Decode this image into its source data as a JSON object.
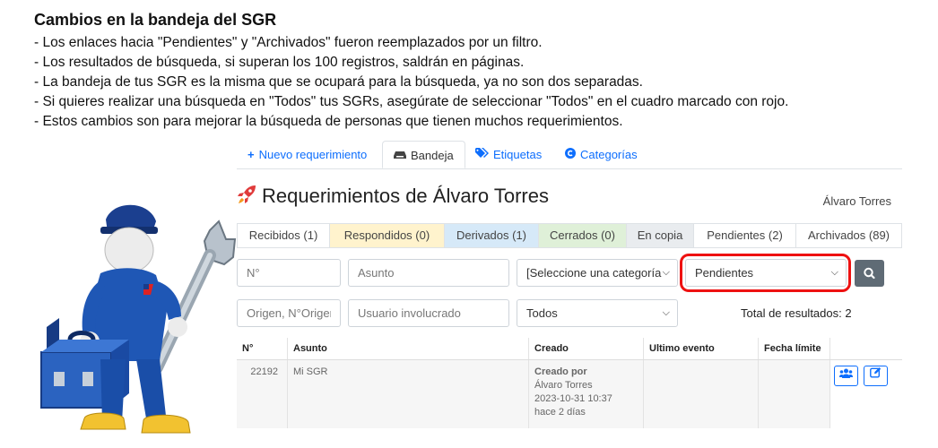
{
  "notice": {
    "title": "Cambios en la bandeja del SGR",
    "lines": [
      "- Los enlaces hacia \"Pendientes\" y \"Archivados\" fueron reemplazados por un filtro.",
      "- Los resultados de búsqueda, si superan los 100 registros, saldrán en páginas.",
      "- La bandeja de tus SGR es la misma que se ocupará para la búsqueda, ya no son dos separadas.",
      "- Si quieres realizar una búsqueda en \"Todos\" tus SGRs, asegúrate de seleccionar \"Todos\" en el cuadro marcado con rojo.",
      "- Estos cambios son para mejorar la búsqueda de personas que tienen muchos requerimientos."
    ]
  },
  "nav": {
    "tabs": [
      {
        "label": "Nuevo requerimiento",
        "icon": "plus-icon"
      },
      {
        "label": "Bandeja",
        "icon": "inbox-icon"
      },
      {
        "label": "Etiquetas",
        "icon": "tags-icon"
      },
      {
        "label": "Categorías",
        "icon": "copyright-circle-icon"
      }
    ]
  },
  "header": {
    "title": "Requerimientos de Álvaro Torres",
    "user": "Álvaro Torres"
  },
  "status_tabs": [
    {
      "label": "Recibidos (1)",
      "bg": "#ffffff"
    },
    {
      "label": "Respondidos (0)",
      "bg": "#fff3cd"
    },
    {
      "label": "Derivados (1)",
      "bg": "#d6e9f8"
    },
    {
      "label": "Cerrados (0)",
      "bg": "#dff0d8"
    },
    {
      "label": "En copia",
      "bg": "#e9ecef"
    },
    {
      "label": "Pendientes (2)",
      "bg": "#ffffff"
    },
    {
      "label": "Archivados (89)",
      "bg": "#ffffff"
    }
  ],
  "filters": {
    "numero_placeholder": "N°",
    "asunto_placeholder": "Asunto",
    "categoria_value": "[Seleccione una categoría",
    "estado_value": "Pendientes",
    "origen_placeholder": "Origen, N°Origen",
    "usuario_placeholder": "Usuario involucrado",
    "tipo_value": "Todos"
  },
  "total_results": "Total de resultados: 2",
  "table": {
    "headers": [
      "N°",
      "Asunto",
      "Creado",
      "Ultimo evento",
      "Fecha límite",
      ""
    ],
    "rows": [
      {
        "numero": "22192",
        "asunto": "Mi SGR",
        "creado_label": "Creado por",
        "creado_por": "Álvaro Torres",
        "fecha": "2023-10-31 10:37",
        "hace": "hace 2 días",
        "ultimo_evento": "",
        "fecha_limite": ""
      }
    ]
  },
  "colors": {
    "link": "#0d6efd",
    "highlight": "#ee1111",
    "search_button": "#5f6b75"
  }
}
